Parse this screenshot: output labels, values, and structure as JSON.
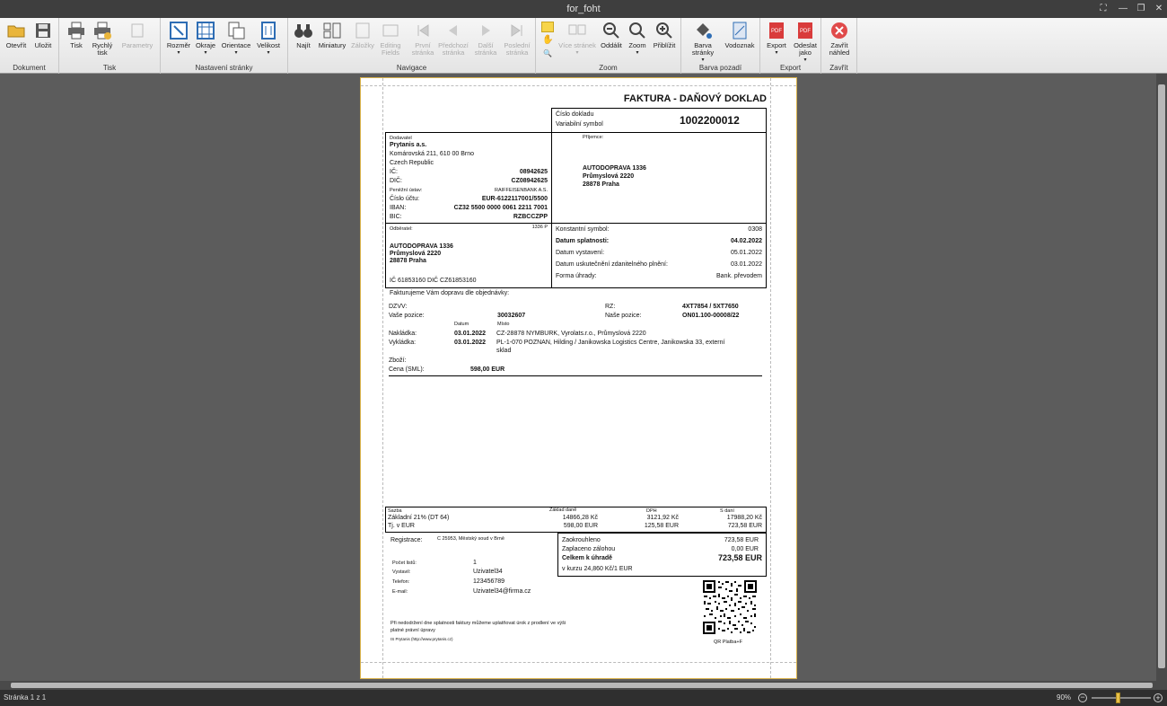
{
  "window": {
    "title": "for_foht"
  },
  "ribbon": {
    "groups": [
      {
        "label": "Dokument",
        "buttons": [
          "Otevřít",
          "Uložit"
        ]
      },
      {
        "label": "Tisk",
        "buttons": [
          "Tisk",
          "Rychlý tisk",
          "Parametry"
        ]
      },
      {
        "label": "Nastavení stránky",
        "buttons": [
          "Rozměr",
          "Okraje",
          "Orientace",
          "Velikost"
        ]
      },
      {
        "label": "Navigace",
        "buttons": [
          "Najít",
          "Miniatury",
          "Záložky",
          "Editing Fields",
          "První stránka",
          "Předchozí stránka",
          "Další stránka",
          "Poslední stránka"
        ]
      },
      {
        "label": "Zoom",
        "buttons": [
          "Více stránek",
          "Oddálit",
          "Zoom",
          "Přiblížit"
        ]
      },
      {
        "label": "Barva pozadí",
        "buttons": [
          "Barva stránky",
          "Vodoznak"
        ]
      },
      {
        "label": "Export",
        "buttons": [
          "Export",
          "Odeslat jako"
        ]
      },
      {
        "label": "Zavřít",
        "buttons": [
          "Zavřít náhled"
        ]
      }
    ]
  },
  "invoice": {
    "title": "FAKTURA - DAŇOVÝ DOKLAD",
    "doc_number_label": "Číslo dokladu",
    "var_symbol_label": "Variabilní symbol",
    "doc_number": "1002200012",
    "supplier": {
      "label": "Dodavatel",
      "name": "Prytanis a.s.",
      "address1": "Komárovská 211, 610 00 Brno",
      "address2": "Czech Republic",
      "ic_label": "IČ:",
      "ic": "08942625",
      "dic_label": "DIČ:",
      "dic": "CZ08942625",
      "bank_label": "Peněžní ústav:",
      "bank": "RAIFFEISENBANK A.S.",
      "account_label": "Číslo účtu:",
      "account": "EUR-6122117001/5500",
      "iban_label": "IBAN:",
      "iban": "CZ32 5500 0000 0061 2211 7001",
      "bic_label": "BIC:",
      "bic": "RZBCCZPP"
    },
    "recipient": {
      "label": "Příjemce:",
      "name": "AUTODOPRAVA 1336",
      "street": "Průmyslová 2220",
      "city": "28878 Praha"
    },
    "customer": {
      "label": "Odběratel:",
      "code": "1336 P",
      "name": "AUTODOPRAVA 1336",
      "street": "Průmyslová 2220",
      "city": "28878 Praha",
      "ids": "IČ 61853160  DIČ CZ61853160"
    },
    "terms": [
      {
        "label": "Konstantní symbol:",
        "value": "0308",
        "bold": false
      },
      {
        "label": "Datum splatnosti:",
        "value": "04.02.2022",
        "bold": true
      },
      {
        "label": "Datum vystavení:",
        "value": "05.01.2022",
        "bold": false
      },
      {
        "label": "Datum uskutečnění zdanitelného plnění:",
        "value": "03.01.2022",
        "bold": false
      },
      {
        "label": "Forma úhrady:",
        "value": "Bank. převodem",
        "bold": false
      }
    ],
    "intro": "Fakturujeme Vám dopravu dle objednávky:",
    "dzvv_label": "DZVV:",
    "your_pos_label": "Vaše pozice:",
    "your_pos": "30032607",
    "rz_label": "RZ:",
    "rz": "4XT7854 / 5XT7650",
    "our_pos_label": "Naše pozice:",
    "our_pos": "ON01.100-00008/22",
    "datum_header": "Datum",
    "misto_header": "Místo",
    "loading_label": "Nakládka:",
    "loading_date": "03.01.2022",
    "loading_place": "CZ-28878 NYMBURK, Vyrolats.r.o., Průmyslová 2220",
    "unloading_label": "Vykládka:",
    "unloading_date": "03.01.2022",
    "unloading_place1": "PL-1-070 POZNAN, Hilding / Janikowska Logistics Centre, Janikowska 33, externí",
    "unloading_place2": "sklad",
    "goods_label": "Zboží:",
    "price_label": "Cena (SML):",
    "price": "598,00 EUR",
    "vat": {
      "sazba_label": "Sazba",
      "base_label": "Základ daně",
      "dph_label": "DPH",
      "sdani_label": "S daní",
      "row1": {
        "name": "Základní 21% (DT 64)",
        "base": "14866,28 Kč",
        "dph": "3121,92 Kč",
        "total": "17988,20 Kč"
      },
      "row2": {
        "name": "Tj. v EUR",
        "base": "598,00 EUR",
        "dph": "125,58 EUR",
        "total": "723,58 EUR"
      }
    },
    "registration_label": "Registrace:",
    "registration": "C 25953, Městský soud v Brně",
    "meta": [
      {
        "label": "Počet listů:",
        "value": "1"
      },
      {
        "label": "Vystavil:",
        "value": "Uzivatel34"
      },
      {
        "label": "Telefon:",
        "value": "123456789"
      },
      {
        "label": "E-mail:",
        "value": "Uzivatel34@firma.cz"
      }
    ],
    "totals": [
      {
        "label": "Zaokrouhleno",
        "value": "723,58 EUR",
        "bold": false
      },
      {
        "label": "Zaplaceno zálohou",
        "value": "0,00 EUR",
        "bold": false
      },
      {
        "label": "Celkem k úhradě",
        "value": "723,58 EUR",
        "bold": true
      }
    ],
    "rate": "v kurzu 24,860 Kč/1 EUR",
    "footer1": "Při nedodržení dne splatnosti faktury můžeme uplatňovat úrok z prodlení ve výši",
    "footer2": "platné právní úpravy",
    "footer3": "IS Prytanis (http://www.prytanis.cz)",
    "qr_label": "QR Platba+F"
  },
  "status": {
    "page": "Stránka 1 z 1",
    "zoom": "90%",
    "zoom_level": 0.9
  }
}
